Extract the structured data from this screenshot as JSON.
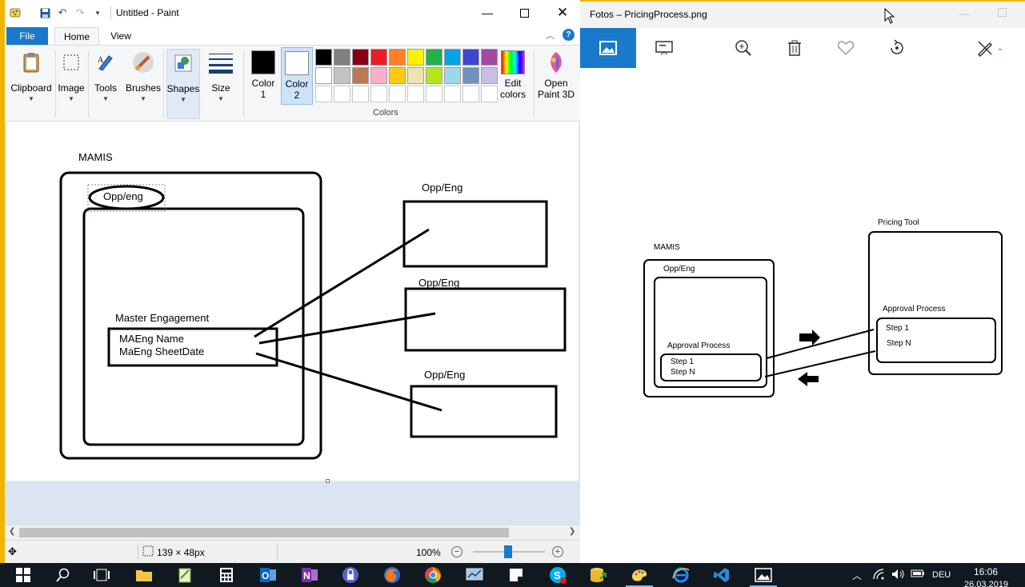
{
  "paint": {
    "title": "Untitled - Paint",
    "tabs": {
      "file": "File",
      "home": "Home",
      "view": "View"
    },
    "help": "?",
    "ribbon": {
      "clipboard": "Clipboard",
      "image": "Image",
      "tools": "Tools",
      "brushes": "Brushes",
      "shapes": "Shapes",
      "size": "Size",
      "color1": [
        "Color",
        "1"
      ],
      "color2": [
        "Color",
        "2"
      ],
      "edit_colors": [
        "Edit",
        "colors"
      ],
      "open_paint3d": [
        "Open",
        "Paint 3D"
      ],
      "colors_group": "Colors"
    },
    "palette": [
      "#000000",
      "#7f7f7f",
      "#880015",
      "#ed1c24",
      "#ff7f27",
      "#fff200",
      "#22b14c",
      "#00a2e8",
      "#3f48cc",
      "#a349a4",
      "#ffffff",
      "#c3c3c3",
      "#b97a57",
      "#ffaec9",
      "#ffc90e",
      "#efe4b0",
      "#b5e61d",
      "#99d9ea",
      "#7092be",
      "#c8bfe7",
      "#ffffff",
      "#ffffff",
      "#ffffff",
      "#ffffff",
      "#ffffff",
      "#ffffff",
      "#ffffff",
      "#ffffff",
      "#ffffff",
      "#ffffff"
    ],
    "color1_value": "#000000",
    "color2_value": "#ffffff",
    "drawing": {
      "mamis": "MAMIS",
      "opp_eng_ellipse": "Opp/eng",
      "master_engagement": "Master Engagement",
      "maeng_name": "MAEng Name",
      "maeng_sheetdate": "MaEng SheetDate",
      "box_labels": [
        "Opp/Eng",
        "Opp/Eng",
        "Opp/Eng"
      ]
    },
    "status": {
      "selection_size": "139 × 48px",
      "zoom": "100%"
    }
  },
  "photos": {
    "title": "Fotos – PricingProcess.png",
    "image": {
      "mamis": "MAMIS",
      "opp_eng": "Opp/Eng",
      "approval_left": "Approval Process",
      "step1_left": "Step 1",
      "stepn_left": "Step N",
      "pricing_tool": "Pricing Tool",
      "approval_right": "Approval Process",
      "step1_right": "Step 1",
      "stepn_right": "Step N"
    }
  },
  "taskbar": {
    "language": "DEU",
    "time": "16:06",
    "date": "26.03.2019"
  }
}
